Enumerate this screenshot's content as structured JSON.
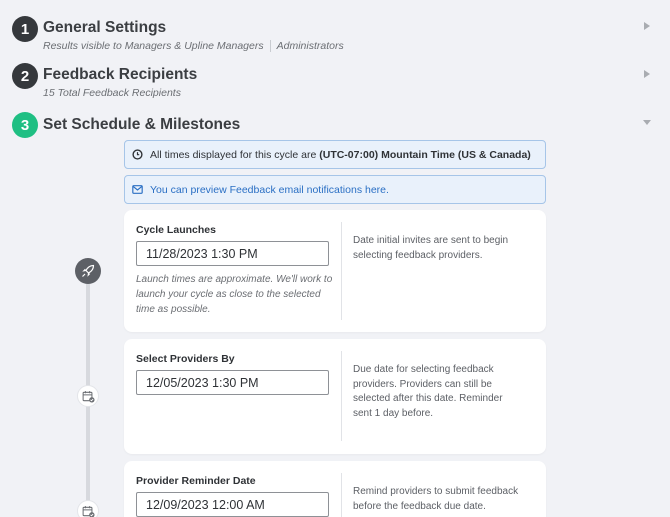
{
  "steps": [
    {
      "number": "1",
      "title": "General Settings",
      "subtitle_a": "Results visible to Managers & Upline Managers",
      "subtitle_b": "Administrators"
    },
    {
      "number": "2",
      "title": "Feedback Recipients",
      "subtitle": "15 Total Feedback Recipients"
    },
    {
      "number": "3",
      "title": "Set Schedule & Milestones"
    }
  ],
  "banners": {
    "timezone_prefix": "All times displayed for this cycle are ",
    "timezone_value": "(UTC-07:00) Mountain Time (US & Canada)",
    "preview_link": "You can preview Feedback email notifications here."
  },
  "milestones": [
    {
      "label": "Cycle Launches",
      "value": "11/28/2023 1:30 PM",
      "note": "Launch times are approximate. We'll work to launch your cycle as close to the selected time as possible.",
      "description": "Date initial invites are sent to begin selecting feedback providers."
    },
    {
      "label": "Select Providers By",
      "value": "12/05/2023 1:30 PM",
      "description": "Due date for selecting feedback providers. Providers can still be selected after this date. Reminder sent 1 day before."
    },
    {
      "label": "Provider Reminder Date",
      "value": "12/09/2023 12:00 AM",
      "description": "Remind providers to submit feedback before the feedback due date."
    }
  ],
  "colors": {
    "accent_green": "#1fbf83",
    "dark_step": "#35383c",
    "link_blue": "#2a6fc4"
  },
  "icons": [
    "chevron-right-icon",
    "chevron-down-icon",
    "clock-icon",
    "mail-icon",
    "rocket-icon",
    "calendar-check-icon"
  ]
}
